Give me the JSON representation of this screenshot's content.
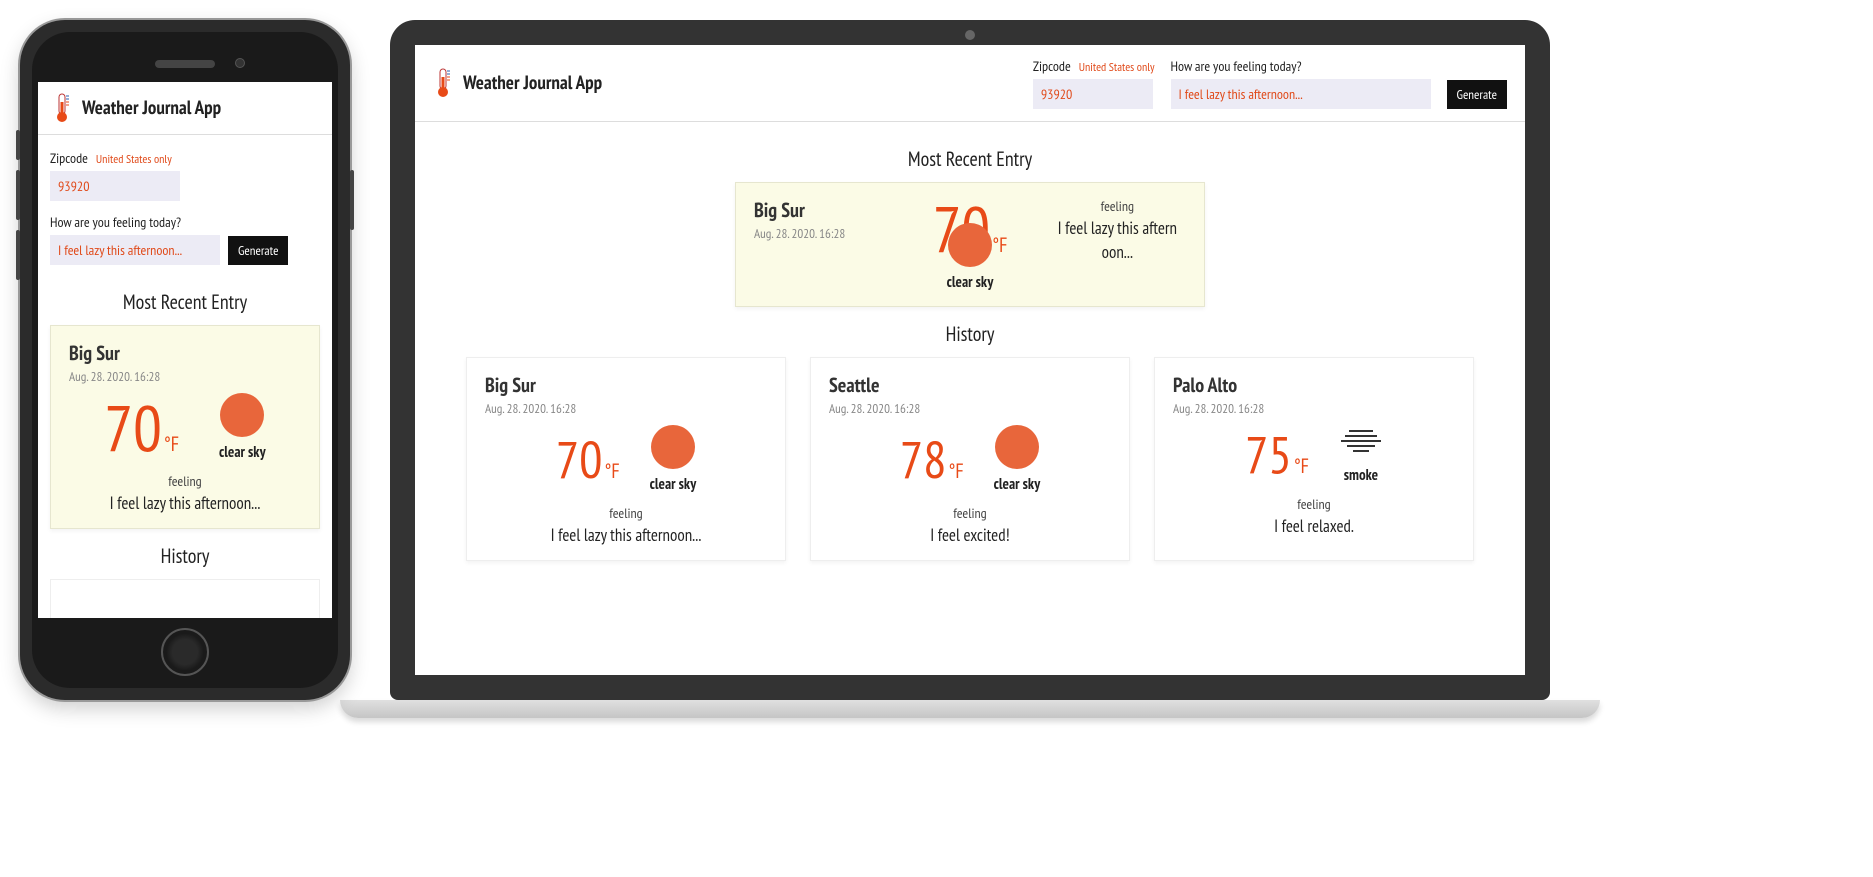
{
  "app": {
    "title": "Weather Journal App",
    "form": {
      "zipcode_label": "Zipcode",
      "zipcode_hint": "United States only",
      "zipcode_value": "93920",
      "feelings_label": "How are you feeling today?",
      "feelings_value": "I feel lazy this afternoon...",
      "generate_label": "Generate"
    },
    "sections": {
      "recent": "Most Recent Entry",
      "history": "History"
    },
    "recent": {
      "city": "Big Sur",
      "timestamp": "Aug. 28. 2020. 16:28",
      "temp": "70",
      "unit": "°F",
      "condition": "clear sky",
      "icon": "sun",
      "feeling_label": "feeling",
      "feeling_text_wrapped_a": "I feel lazy this aftern",
      "feeling_text_wrapped_b": "oon...",
      "feeling_text": "I feel lazy this afternoon..."
    },
    "history": [
      {
        "city": "Big Sur",
        "timestamp": "Aug. 28. 2020. 16:28",
        "temp": "70",
        "unit": "°F",
        "condition": "clear sky",
        "icon": "sun",
        "feeling_label": "feeling",
        "feeling_text": "I feel lazy this afternoon..."
      },
      {
        "city": "Seattle",
        "timestamp": "Aug. 28. 2020. 16:28",
        "temp": "78",
        "unit": "°F",
        "condition": "clear sky",
        "icon": "sun",
        "feeling_label": "feeling",
        "feeling_text": "I feel excited!"
      },
      {
        "city": "Palo Alto",
        "timestamp": "Aug. 28. 2020. 16:28",
        "temp": "75",
        "unit": "°F",
        "condition": "smoke",
        "icon": "smoke",
        "feeling_label": "feeling",
        "feeling_text": "I feel relaxed."
      }
    ]
  }
}
